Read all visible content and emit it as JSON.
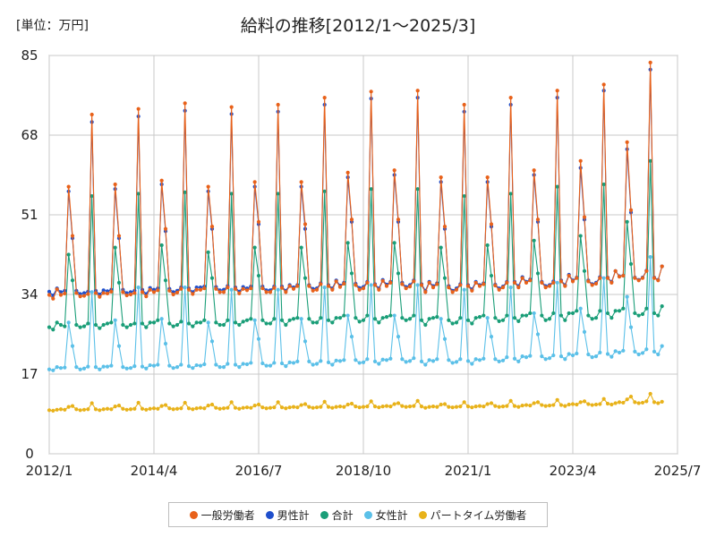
{
  "chart_data": {
    "type": "line",
    "title": "給料の推移[2012/1～2025/3]",
    "unit_label": "[単位：万円]",
    "grid": true,
    "legend_position": "bottom",
    "ylim": [
      0,
      85
    ],
    "y_ticks": [
      0,
      17,
      34,
      51,
      68,
      85
    ],
    "x_tick_labels": [
      "2012/1",
      "2014/4",
      "2016/7",
      "2018/10",
      "2021/1",
      "2023/4",
      "2025/7"
    ],
    "x_start": "2012/1",
    "x_end": "2025/3",
    "series": [
      {
        "name": "一般労働者",
        "color": "#e8611a",
        "values": [
          33.9,
          33.1,
          35.1,
          33.9,
          34.2,
          57.0,
          46.5,
          34.3,
          33.6,
          33.7,
          34.1,
          72.4,
          34.3,
          33.5,
          34.3,
          34.2,
          34.6,
          57.5,
          46.5,
          34.5,
          33.8,
          34.0,
          34.3,
          73.6,
          34.5,
          33.6,
          35.0,
          34.5,
          34.9,
          58.3,
          48.0,
          34.8,
          34.0,
          34.4,
          35.2,
          74.8,
          35.0,
          34.1,
          35.0,
          35.0,
          35.3,
          57.0,
          48.5,
          35.2,
          34.5,
          34.5,
          35.5,
          74.0,
          35.2,
          34.2,
          35.2,
          34.9,
          35.3,
          58.0,
          49.5,
          35.3,
          34.5,
          34.5,
          35.4,
          74.5,
          35.4,
          34.5,
          35.8,
          35.2,
          35.8,
          58.0,
          49.0,
          35.8,
          34.8,
          35.0,
          36.2,
          76.0,
          35.8,
          35.0,
          36.8,
          35.6,
          36.3,
          60.0,
          50.0,
          36.0,
          35.0,
          35.3,
          36.5,
          77.3,
          36.0,
          35.0,
          36.9,
          35.8,
          36.5,
          60.5,
          50.0,
          36.2,
          35.3,
          35.7,
          36.8,
          77.5,
          36.0,
          34.5,
          36.5,
          35.5,
          36.2,
          59.0,
          48.5,
          35.5,
          34.5,
          35.0,
          36.0,
          74.5,
          35.8,
          34.8,
          36.5,
          35.8,
          36.2,
          59.0,
          49.0,
          35.9,
          35.0,
          35.5,
          36.5,
          76.0,
          36.5,
          35.5,
          37.5,
          36.5,
          37.0,
          60.5,
          50.0,
          36.5,
          35.5,
          35.8,
          36.5,
          77.5,
          36.8,
          35.8,
          38.0,
          36.8,
          37.5,
          62.5,
          50.5,
          36.8,
          36.0,
          36.3,
          37.5,
          78.8,
          37.5,
          36.5,
          39.0,
          37.8,
          38.0,
          66.5,
          52.0,
          37.5,
          37.0,
          37.5,
          39.0,
          83.5,
          37.5,
          37.0,
          40.0
        ]
      },
      {
        "name": "男性計",
        "color": "#1f4fcc",
        "values": [
          34.6,
          33.8,
          35.3,
          34.5,
          34.8,
          56.0,
          46.0,
          34.8,
          34.1,
          34.3,
          34.6,
          70.8,
          34.8,
          34.0,
          34.9,
          34.7,
          35.0,
          56.5,
          46.0,
          35.0,
          34.3,
          34.5,
          34.8,
          72.0,
          35.0,
          34.1,
          35.4,
          35.0,
          35.3,
          57.5,
          47.5,
          35.2,
          34.5,
          34.8,
          35.5,
          73.2,
          35.3,
          34.5,
          35.5,
          35.5,
          35.7,
          56.0,
          48.0,
          35.6,
          34.9,
          35.0,
          35.8,
          72.5,
          35.5,
          34.6,
          35.6,
          35.3,
          35.7,
          57.0,
          49.0,
          35.7,
          34.9,
          34.9,
          35.7,
          73.0,
          35.7,
          34.8,
          36.0,
          35.5,
          36.0,
          57.0,
          48.0,
          36.0,
          35.2,
          35.3,
          36.4,
          74.5,
          36.0,
          35.3,
          37.0,
          35.9,
          36.5,
          59.0,
          49.5,
          36.3,
          35.4,
          35.6,
          36.7,
          75.8,
          36.2,
          35.3,
          37.1,
          36.1,
          36.7,
          59.5,
          49.5,
          36.5,
          35.6,
          36.0,
          37.0,
          76.0,
          36.2,
          34.8,
          36.7,
          35.8,
          36.4,
          58.0,
          48.0,
          35.8,
          34.8,
          35.3,
          36.2,
          73.0,
          36.0,
          35.1,
          36.7,
          36.0,
          36.4,
          58.0,
          48.5,
          36.1,
          35.3,
          35.7,
          36.7,
          74.5,
          36.7,
          35.8,
          37.7,
          36.7,
          37.2,
          59.5,
          49.5,
          36.7,
          35.8,
          36.0,
          36.8,
          76.0,
          37.0,
          36.0,
          38.2,
          37.0,
          37.6,
          61.0,
          50.0,
          37.0,
          36.2,
          36.5,
          37.7,
          77.5,
          37.6,
          36.7,
          39.0,
          37.9,
          38.0,
          65.0,
          51.5,
          37.6,
          37.1,
          37.6,
          39.1,
          82.0,
          37.6,
          37.1,
          40.0
        ]
      },
      {
        "name": "合計",
        "color": "#1a9e78",
        "values": [
          27.0,
          26.5,
          28.0,
          27.5,
          27.2,
          42.5,
          37.0,
          27.5,
          27.0,
          27.2,
          27.8,
          55.0,
          27.5,
          26.8,
          27.5,
          27.8,
          28.0,
          44.0,
          36.5,
          27.5,
          27.0,
          27.5,
          27.8,
          55.5,
          27.8,
          27.0,
          28.0,
          28.0,
          28.5,
          44.5,
          37.0,
          27.8,
          27.2,
          27.5,
          28.2,
          55.8,
          27.8,
          27.2,
          28.0,
          28.0,
          28.5,
          43.0,
          37.5,
          28.0,
          27.5,
          27.5,
          28.5,
          55.5,
          28.0,
          27.5,
          28.2,
          28.5,
          28.8,
          44.0,
          38.0,
          28.5,
          27.8,
          27.8,
          28.8,
          55.5,
          28.5,
          27.5,
          28.5,
          28.8,
          29.0,
          44.0,
          37.5,
          28.8,
          28.0,
          28.0,
          29.0,
          56.0,
          28.5,
          28.0,
          29.0,
          29.0,
          29.5,
          45.0,
          38.5,
          29.0,
          28.2,
          28.5,
          29.5,
          56.5,
          28.8,
          28.0,
          29.0,
          29.2,
          29.5,
          45.0,
          38.5,
          29.0,
          28.5,
          28.8,
          29.5,
          56.5,
          28.5,
          27.5,
          28.8,
          29.0,
          29.2,
          44.0,
          37.5,
          28.5,
          27.8,
          28.0,
          29.0,
          55.0,
          28.5,
          27.8,
          29.0,
          29.2,
          29.5,
          44.5,
          38.0,
          29.0,
          28.3,
          28.5,
          29.5,
          55.5,
          29.0,
          28.3,
          29.5,
          29.5,
          30.0,
          45.5,
          38.5,
          29.5,
          28.5,
          28.8,
          30.0,
          57.0,
          29.5,
          28.5,
          30.0,
          30.0,
          30.5,
          46.5,
          39.0,
          29.5,
          28.8,
          29.0,
          30.5,
          57.5,
          30.0,
          29.0,
          30.5,
          30.5,
          31.0,
          49.5,
          40.5,
          30.0,
          29.5,
          29.8,
          31.0,
          62.5,
          30.0,
          29.5,
          31.5
        ]
      },
      {
        "name": "女性計",
        "color": "#5bc0e8",
        "values": [
          18.0,
          17.8,
          18.5,
          18.3,
          18.4,
          28.0,
          23.0,
          18.5,
          18.0,
          18.2,
          18.6,
          34.5,
          18.5,
          18.0,
          18.6,
          18.6,
          18.8,
          28.5,
          23.0,
          18.5,
          18.2,
          18.3,
          18.7,
          35.5,
          18.6,
          18.2,
          18.9,
          18.8,
          19.0,
          28.8,
          23.5,
          18.8,
          18.3,
          18.5,
          19.0,
          35.5,
          18.7,
          18.3,
          18.9,
          18.8,
          19.1,
          28.0,
          24.0,
          19.0,
          18.5,
          18.5,
          19.2,
          35.0,
          19.0,
          18.5,
          19.2,
          19.1,
          19.4,
          28.5,
          24.5,
          19.3,
          18.8,
          18.8,
          19.4,
          35.0,
          19.3,
          18.7,
          19.5,
          19.4,
          19.7,
          28.8,
          24.0,
          19.7,
          19.0,
          19.2,
          19.8,
          35.5,
          19.5,
          19.0,
          19.9,
          19.8,
          20.0,
          29.5,
          25.0,
          20.0,
          19.4,
          19.5,
          20.2,
          36.0,
          19.7,
          19.2,
          20.1,
          20.0,
          20.3,
          29.5,
          25.0,
          20.2,
          19.6,
          19.8,
          20.4,
          36.0,
          19.7,
          19.0,
          20.0,
          19.8,
          20.2,
          28.8,
          24.5,
          20.0,
          19.4,
          19.6,
          20.2,
          35.0,
          19.8,
          19.2,
          20.2,
          20.0,
          20.3,
          29.0,
          25.0,
          20.2,
          19.7,
          19.9,
          20.6,
          35.5,
          20.3,
          19.7,
          20.8,
          20.6,
          20.9,
          30.0,
          25.5,
          20.8,
          20.2,
          20.4,
          21.0,
          36.5,
          20.8,
          20.2,
          21.3,
          21.0,
          21.4,
          31.0,
          26.0,
          21.2,
          20.6,
          20.8,
          21.6,
          37.5,
          21.3,
          20.7,
          21.9,
          21.6,
          22.0,
          33.5,
          27.0,
          21.8,
          21.2,
          21.5,
          22.3,
          42.0,
          21.8,
          21.2,
          23.0
        ]
      },
      {
        "name": "パートタイム労働者",
        "color": "#e8b21a",
        "values": [
          9.3,
          9.2,
          9.4,
          9.5,
          9.4,
          10.0,
          10.2,
          9.5,
          9.3,
          9.4,
          9.5,
          10.8,
          9.5,
          9.3,
          9.5,
          9.6,
          9.5,
          10.1,
          10.3,
          9.6,
          9.4,
          9.5,
          9.6,
          10.9,
          9.6,
          9.4,
          9.6,
          9.7,
          9.6,
          10.2,
          10.4,
          9.7,
          9.5,
          9.6,
          9.7,
          10.9,
          9.7,
          9.5,
          9.7,
          9.8,
          9.7,
          10.3,
          10.5,
          9.8,
          9.6,
          9.7,
          9.8,
          11.0,
          9.8,
          9.6,
          9.8,
          9.9,
          9.8,
          10.3,
          10.5,
          9.9,
          9.7,
          9.8,
          9.9,
          11.0,
          9.9,
          9.7,
          9.9,
          10.0,
          9.9,
          10.4,
          10.6,
          10.0,
          9.8,
          9.9,
          10.0,
          11.1,
          10.0,
          9.8,
          10.0,
          10.1,
          10.0,
          10.5,
          10.7,
          10.1,
          9.9,
          10.0,
          10.1,
          11.2,
          10.1,
          9.9,
          10.1,
          10.2,
          10.1,
          10.6,
          10.8,
          10.2,
          10.0,
          10.1,
          10.2,
          11.3,
          10.1,
          9.8,
          10.0,
          10.1,
          10.0,
          10.5,
          10.6,
          10.0,
          9.9,
          10.0,
          10.1,
          11.0,
          10.1,
          9.9,
          10.1,
          10.2,
          10.1,
          10.6,
          10.8,
          10.2,
          10.0,
          10.1,
          10.2,
          11.3,
          10.2,
          10.0,
          10.3,
          10.4,
          10.3,
          10.8,
          11.0,
          10.4,
          10.2,
          10.3,
          10.4,
          11.5,
          10.4,
          10.2,
          10.5,
          10.6,
          10.5,
          11.0,
          11.2,
          10.6,
          10.4,
          10.5,
          10.6,
          11.7,
          10.7,
          10.5,
          10.8,
          11.0,
          10.9,
          11.6,
          12.2,
          11.0,
          10.8,
          10.9,
          11.2,
          12.8,
          11.0,
          10.8,
          11.1
        ]
      }
    ]
  }
}
